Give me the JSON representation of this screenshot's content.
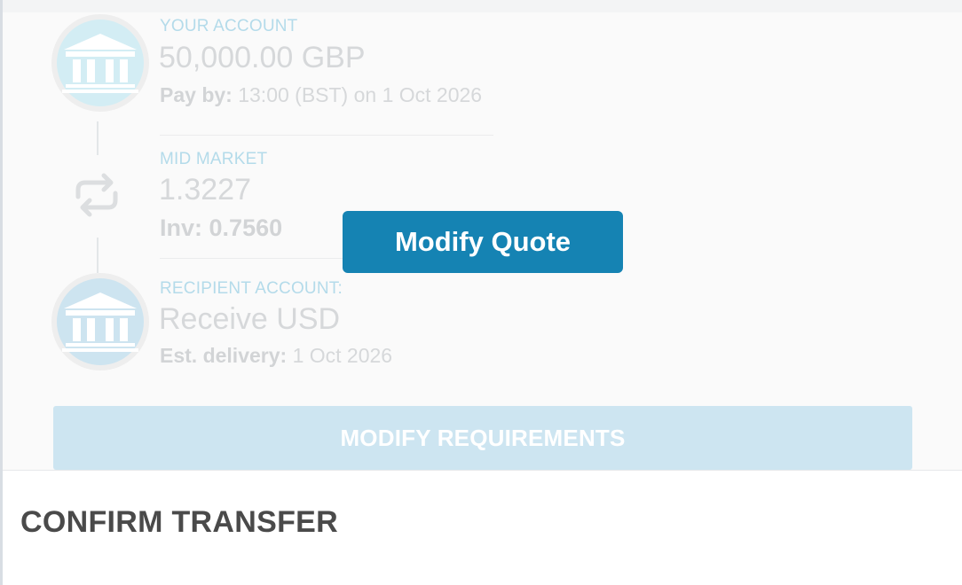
{
  "your_account": {
    "label": "YOUR ACCOUNT",
    "amount": "50,000.00 GBP",
    "pay_by_label": "Pay by:",
    "pay_by_value": "13:00 (BST) on 1 Oct 2026"
  },
  "mid_market": {
    "label": "MID MARKET",
    "rate": "1.3227",
    "inv_label": "Inv:",
    "inv_value": "0.7560"
  },
  "recipient_account": {
    "label": "RECIPIENT ACCOUNT:",
    "amount": "Receive USD",
    "delivery_label": "Est. delivery:",
    "delivery_value": "1 Oct 2026"
  },
  "buttons": {
    "modify_quote": "Modify Quote",
    "modify_requirements": "MODIFY REQUIREMENTS"
  },
  "confirm_section": {
    "title": "CONFIRM TRANSFER"
  },
  "icons": {
    "account": "bank-icon",
    "recipient": "bank-icon",
    "rate": "swap-icon"
  },
  "colors": {
    "primary_button": "#1583b3",
    "faded_button": "#cde5f1",
    "label_blue": "#b4dbea"
  }
}
